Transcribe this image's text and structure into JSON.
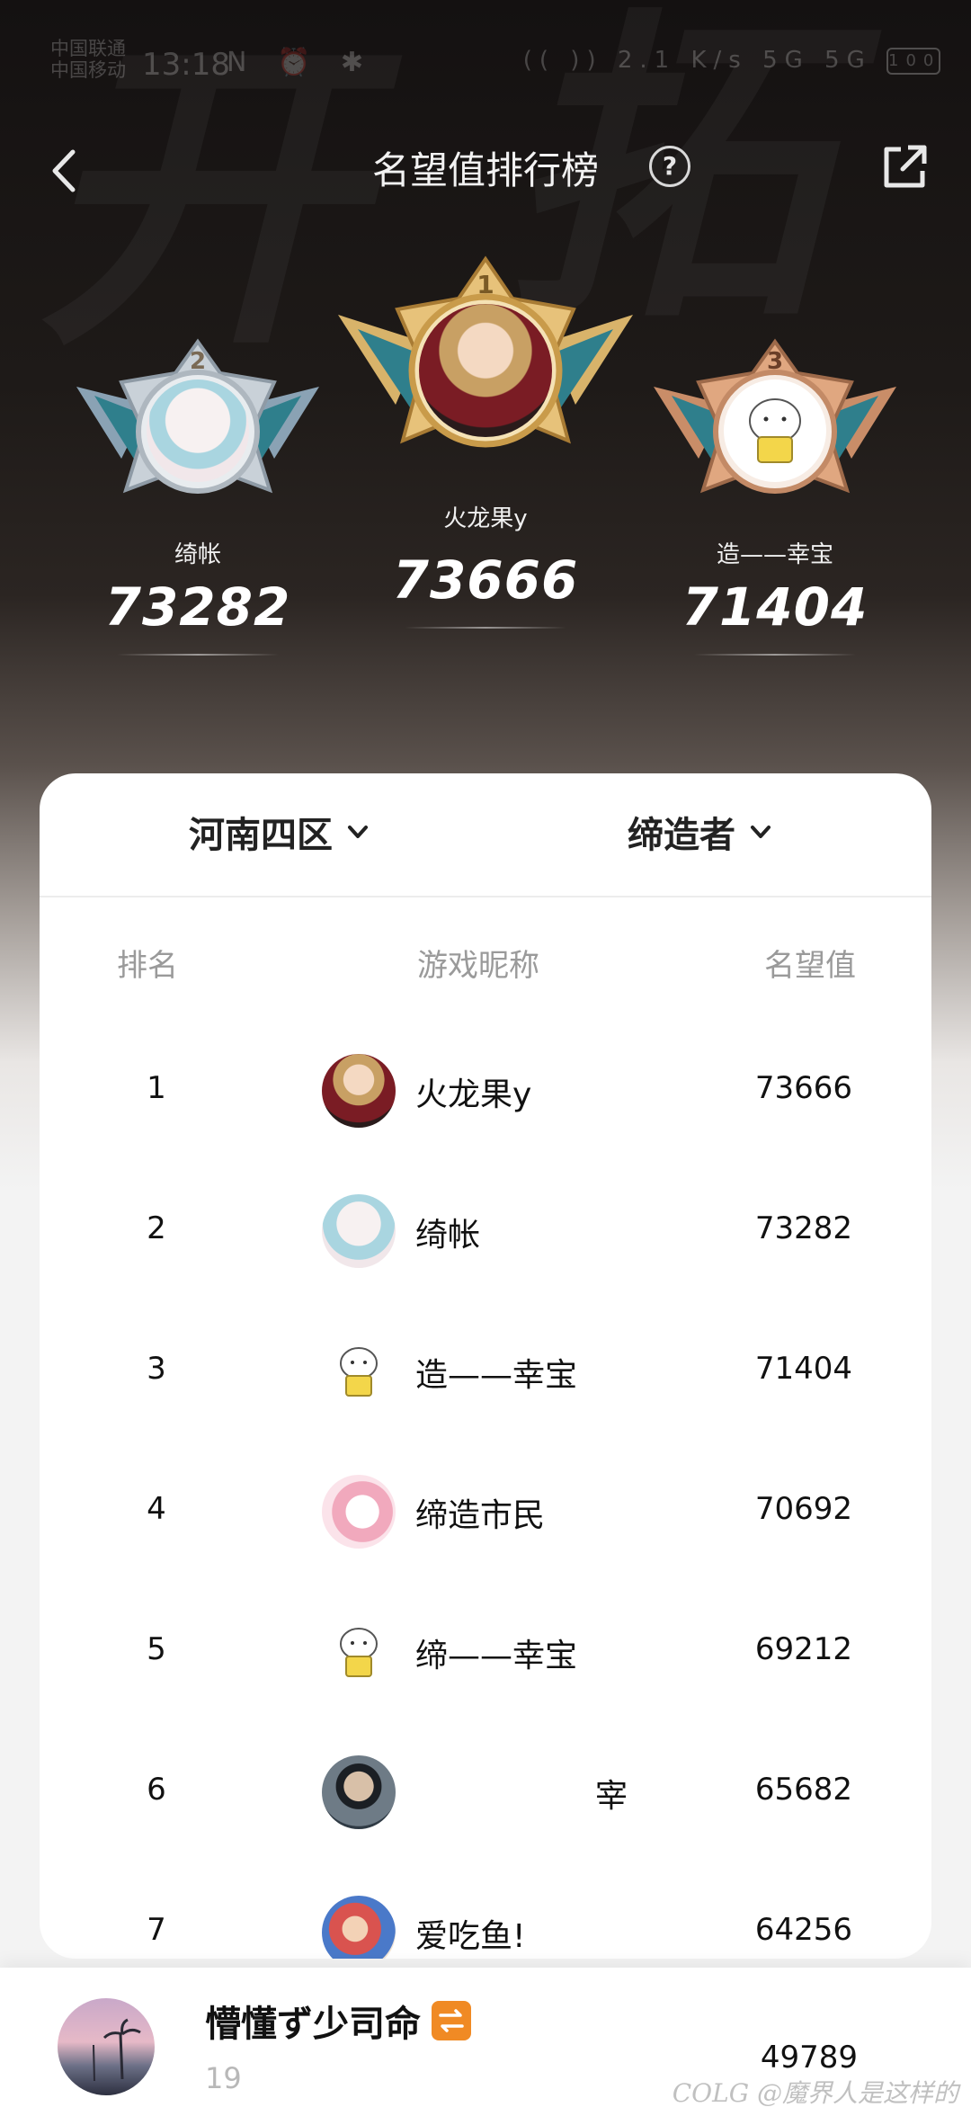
{
  "status_bar": {
    "carrier_line1": "中国联通",
    "carrier_line2": "中国移动",
    "time": "13:18",
    "icons_left": "N ⏰ ✱",
    "icons_right": "(( )) 2.1 K/s 5G 5G",
    "battery": "100"
  },
  "header": {
    "title": "名望值排行榜",
    "help_label": "?"
  },
  "podium": [
    {
      "place": "2",
      "name": "绮帐",
      "score": "73282"
    },
    {
      "place": "1",
      "name": "火龙果y",
      "score": "73666"
    },
    {
      "place": "3",
      "name": "造——幸宝",
      "score": "71404"
    }
  ],
  "filters": {
    "region": "河南四区",
    "class": "缔造者"
  },
  "table": {
    "columns": [
      "排名",
      "游戏昵称",
      "名望值"
    ],
    "rows": [
      {
        "rank": "1",
        "name": "火龙果y",
        "score": "73666"
      },
      {
        "rank": "2",
        "name": "绮帐",
        "score": "73282"
      },
      {
        "rank": "3",
        "name": "造——幸宝",
        "score": "71404"
      },
      {
        "rank": "4",
        "name": "缔造市民",
        "score": "70692"
      },
      {
        "rank": "5",
        "name": "缔——幸宝",
        "score": "69212"
      },
      {
        "rank": "6",
        "name": "宰",
        "score": "65682"
      },
      {
        "rank": "7",
        "name": "爱吃鱼!",
        "score": "64256"
      }
    ]
  },
  "me": {
    "name": "懵懂ず少司命",
    "rank": "19",
    "score": "49789"
  },
  "watermark": "COLG @魔界人是这样的",
  "colors": {
    "gold": "#e3b25a",
    "silver": "#b9c2cc",
    "bronze": "#d79a72",
    "accent_orange": "#f08a24"
  }
}
